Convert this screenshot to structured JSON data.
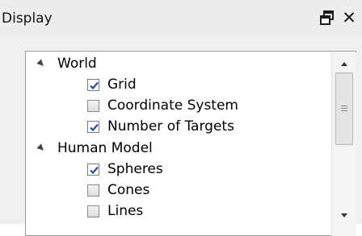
{
  "panel": {
    "title": "Display",
    "float_icon": "float-window-icon",
    "close_icon": "close-icon",
    "close_glyph": "✕"
  },
  "tree": {
    "nodes": [
      {
        "label": "World",
        "type": "group",
        "expanded": true
      },
      {
        "label": "Grid",
        "type": "item",
        "checked": true
      },
      {
        "label": "Coordinate System",
        "type": "item",
        "checked": false
      },
      {
        "label": "Number of Targets",
        "type": "item",
        "checked": true
      },
      {
        "label": "Human Model",
        "type": "group",
        "expanded": true
      },
      {
        "label": "Spheres",
        "type": "item",
        "checked": true
      },
      {
        "label": "Cones",
        "type": "item",
        "checked": false
      },
      {
        "label": "Lines",
        "type": "item",
        "checked": false
      }
    ]
  },
  "colors": {
    "titlebar_bg": "#ededed",
    "panel_bg": "#f0f0f0",
    "check_color": "#1f4fa8"
  }
}
